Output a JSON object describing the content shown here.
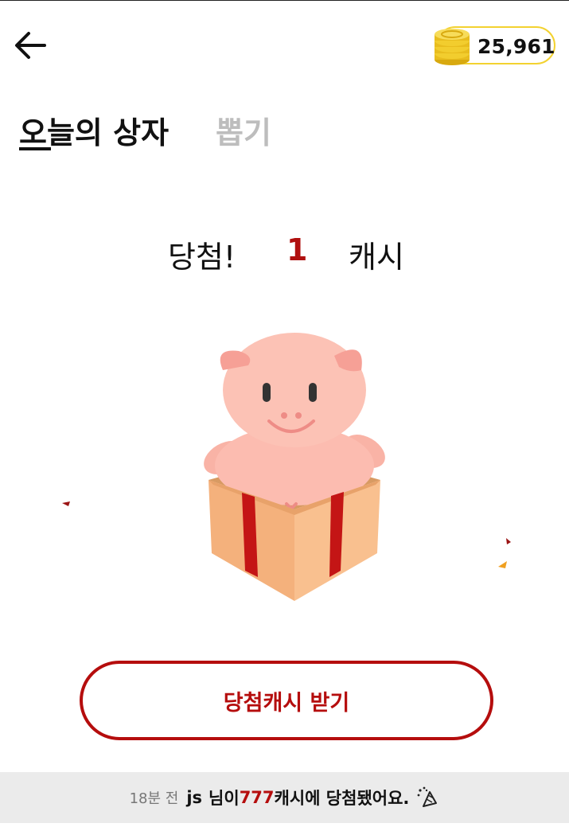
{
  "header": {
    "coin_balance": "25,961"
  },
  "tabs": [
    {
      "label": "오늘의 상자",
      "active": true
    },
    {
      "label": "뽑기",
      "active": false
    }
  ],
  "prize": {
    "prefix": "당첨!",
    "amount": "1",
    "unit": "캐시"
  },
  "claim_button": {
    "label": "당첨캐시 받기"
  },
  "ticker": {
    "time": "18분 전",
    "user": "js",
    "middle": "님이",
    "amount": "777",
    "tail": "캐시에 당첨됐어요."
  },
  "colors": {
    "accent": "#b50d0d",
    "coin_border": "#f3d230",
    "inactive_tab": "#bdbdbd",
    "ticker_bg": "#ebebeb"
  }
}
